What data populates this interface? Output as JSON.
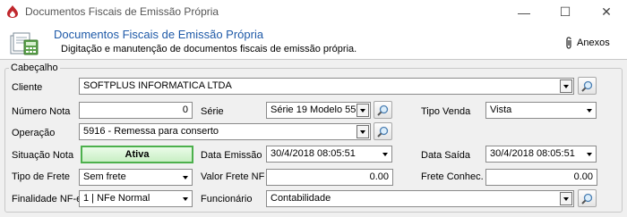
{
  "window": {
    "title": "Documentos Fiscais de Emissão Própria",
    "minimize_glyph": "—",
    "maximize_glyph": "☐",
    "close_glyph": "✕"
  },
  "header": {
    "title": "Documentos Fiscais de Emissão Própria",
    "subtitle": "Digitação e manutenção de documentos fiscais de emissão própria.",
    "anexos_label": "Anexos"
  },
  "group": {
    "title": "Cabeçalho"
  },
  "form": {
    "cliente": {
      "label": "Cliente",
      "value": "SOFTPLUS INFORMATICA LTDA"
    },
    "numero_nota": {
      "label": "Número Nota",
      "value": "0"
    },
    "serie": {
      "label": "Série",
      "value": "Série 19 Modelo 55"
    },
    "tipo_venda": {
      "label": "Tipo Venda",
      "value": "Vista"
    },
    "operacao": {
      "label": "Operação",
      "value": "5916  - Remessa para conserto"
    },
    "situacao_nota": {
      "label": "Situação Nota",
      "value": "Ativa"
    },
    "data_emissao": {
      "label": "Data Emissão",
      "value": "30/4/2018 08:05:51"
    },
    "data_saida": {
      "label": "Data Saída",
      "value": "30/4/2018 08:05:51"
    },
    "tipo_frete": {
      "label": "Tipo de Frete",
      "value": "Sem frete"
    },
    "valor_frete_nf": {
      "label": "Valor Frete NF",
      "value": "0.00"
    },
    "frete_conhec": {
      "label": "Frete Conhec.",
      "value": "0.00"
    },
    "finalidade_nfe": {
      "label": "Finalidade NF-e",
      "value": "1 | NFe Normal"
    },
    "funcionario": {
      "label": "Funcionário",
      "value": "Contabilidade"
    }
  },
  "icons": {
    "app": "document-flame-icon",
    "header": "documents-calculator-icon",
    "anexos": "paperclip-icon",
    "lookup": "magnifier-icon"
  },
  "colors": {
    "header_title": "#1f5aa8",
    "status_border": "#4cb04c",
    "status_fill": "#c9efc4"
  }
}
